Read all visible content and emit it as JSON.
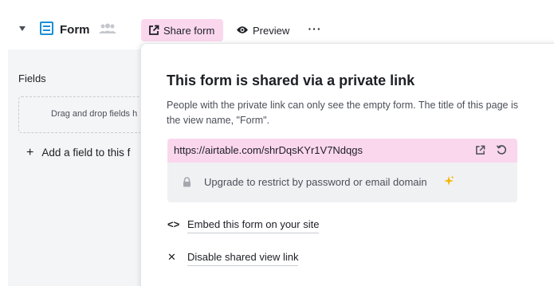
{
  "toolbar": {
    "view_name": "Form",
    "share_label": "Share form",
    "preview_label": "Preview",
    "more_label": "···"
  },
  "left_panel": {
    "fields_title": "Fields",
    "drop_hint": "Drag and drop fields h",
    "add_field_label": "Add a field to this f"
  },
  "popover": {
    "title": "This form is shared via a private link",
    "description": "People with the private link can only see the empty form. The title of this page is the view name, \"Form\".",
    "link_url": "https://airtable.com/shrDqsKYr1V7Ndqgs",
    "upgrade_text": "Upgrade to restrict by password or email domain",
    "embed_label": "Embed this form on your site",
    "disable_label": "Disable shared view link"
  },
  "icons": {
    "caret": "caret-down-icon",
    "form": "form-icon",
    "people": "people-icon",
    "share": "share-icon",
    "preview": "eye-icon",
    "open": "open-external-icon",
    "reset": "reset-icon",
    "lock": "lock-icon",
    "sparkle": "sparkle-icon",
    "embed": "code-icon",
    "disable": "close-icon"
  },
  "colors": {
    "share_highlight": "#fbd7ee",
    "form_icon_blue": "#1b8fd6",
    "sparkle_yellow": "#f5b400"
  }
}
